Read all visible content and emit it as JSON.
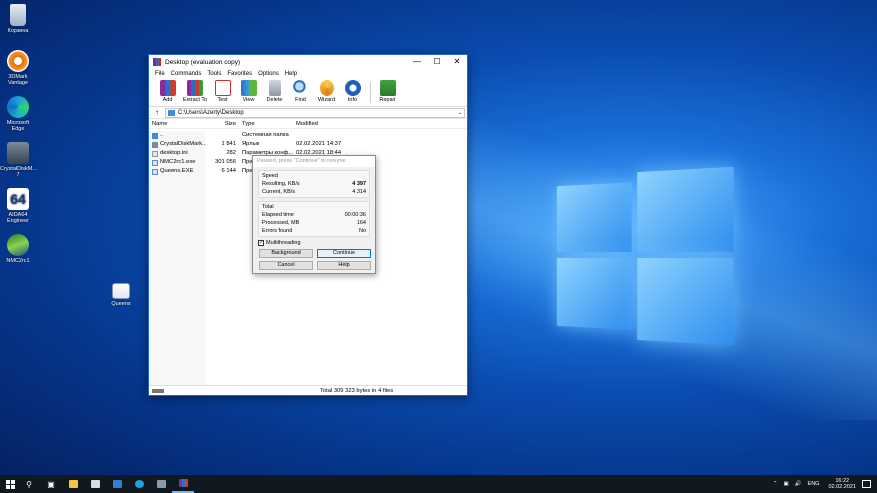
{
  "desktop": {
    "icons": [
      {
        "label": "Корзина"
      },
      {
        "label": "3DMark Vantage"
      },
      {
        "label": "Microsoft Edge"
      },
      {
        "label": "CrystalDiskM... 7"
      },
      {
        "label": "AIDA64 Engineer"
      },
      {
        "label": "NMC2rc1"
      },
      {
        "label": "Queens"
      }
    ]
  },
  "window": {
    "title": "Desktop (evaluation copy)",
    "menu": [
      "File",
      "Commands",
      "Tools",
      "Favorites",
      "Options",
      "Help"
    ],
    "toolbar": [
      "Add",
      "Extract To",
      "Test",
      "View",
      "Delete",
      "Find",
      "Wizard",
      "Info",
      "Repair"
    ],
    "address": "C:\\Users\\Azerty\\Desktop",
    "columns": {
      "name": "Name",
      "size": "Size",
      "type": "Type",
      "modified": "Modified"
    },
    "rows": [
      {
        "name": "..",
        "size": "",
        "type": "Системная папка",
        "modified": ""
      },
      {
        "name": "CrystalDiskMark...",
        "size": "1 841",
        "type": "Ярлык",
        "modified": "02.02.2021 14:37"
      },
      {
        "name": "desktop.ini",
        "size": "282",
        "type": "Параметры конф...",
        "modified": "02.02.2021 18:44"
      },
      {
        "name": "NMC2rc1.exe",
        "size": "301 056",
        "type": "При",
        "modified": ""
      },
      {
        "name": "Queens.EXE",
        "size": "6 144",
        "type": "При",
        "modified": ""
      }
    ],
    "status": "Total 309 323 bytes in 4 files"
  },
  "dialog": {
    "title": "Paused, press \"Continue\" to resume",
    "speed_header": "Speed",
    "resulting_label": "Resulting, KB/s",
    "resulting_value": "4 397",
    "current_label": "Current, KB/s",
    "current_value": "4 314",
    "total_header": "Total",
    "elapsed_label": "Elapsed time",
    "elapsed_value": "00:00:36",
    "processed_label": "Processed, MB",
    "processed_value": "164",
    "errors_label": "Errors found",
    "errors_value": "No",
    "multithreading": "Multithreading",
    "background": "Background",
    "continue": "Continue",
    "cancel": "Cancel",
    "help": "Help"
  },
  "taskbar": {
    "lang": "ENG",
    "time": "16:22",
    "date": "02.02.2021"
  }
}
